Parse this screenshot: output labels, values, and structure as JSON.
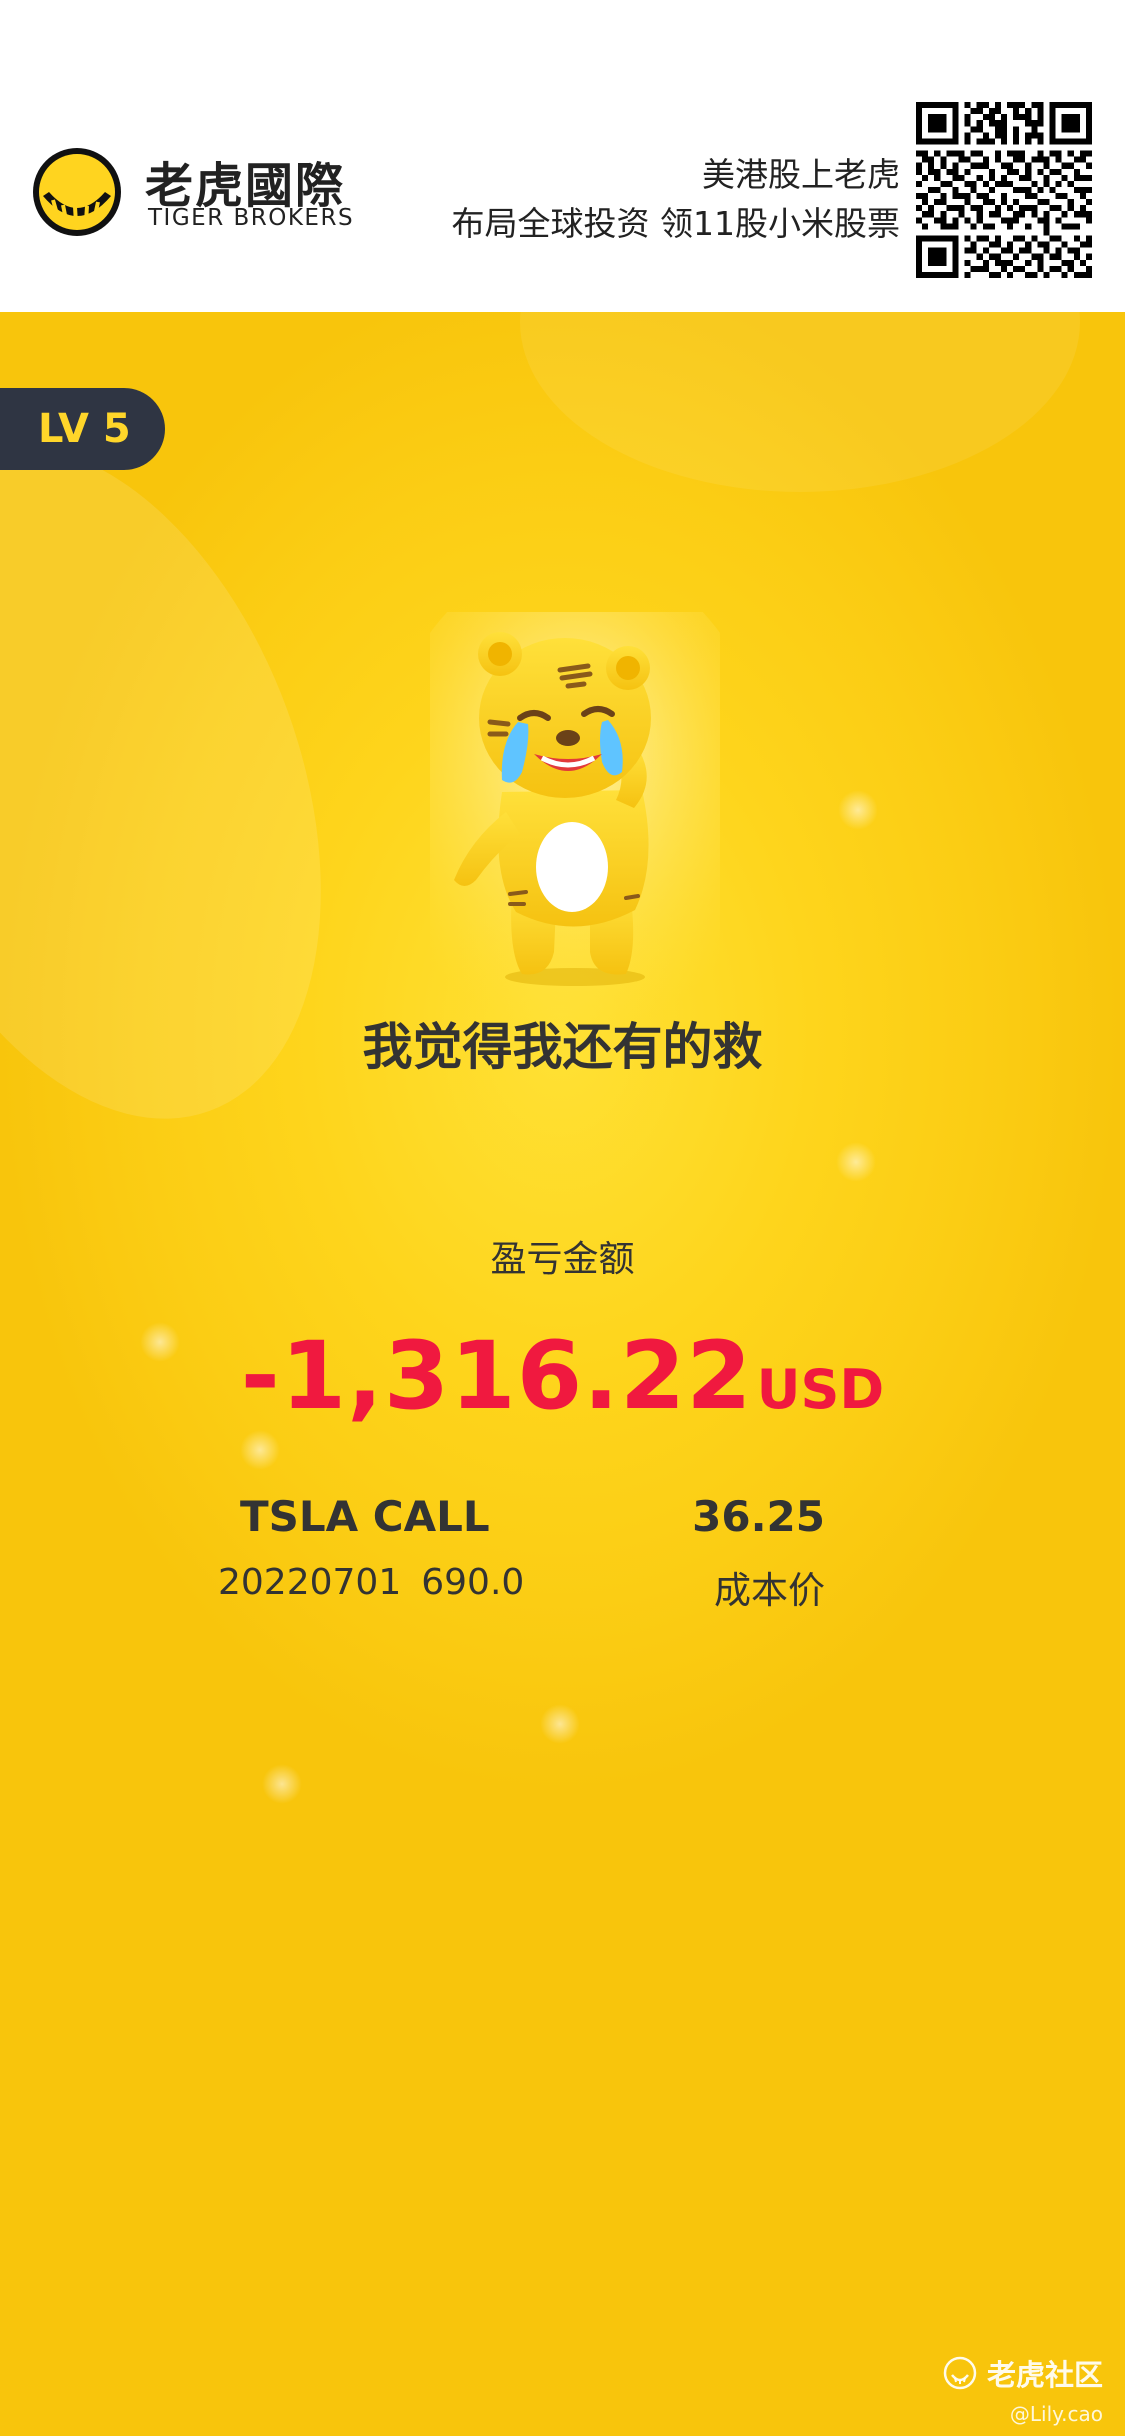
{
  "header": {
    "brand_name_cn": "老虎國際",
    "brand_name_en": "TIGER BROKERS",
    "promo_line_1": "美港股上老虎",
    "promo_line_2": "布局全球投资 领11股小米股票"
  },
  "card": {
    "level_badge": "LV 5",
    "mood_text": "我觉得我还有的救",
    "pnl_label": "盈亏金额",
    "pnl_value": "-1,316.22",
    "pnl_currency": "USD",
    "contract": {
      "name": "TSLA CALL",
      "expiry": "20220701",
      "strike": "690.0"
    },
    "cost": {
      "value": "36.25",
      "label": "成本价"
    },
    "watermark": {
      "brand": "老虎社区",
      "user": "@Lily.cao"
    }
  },
  "colors": {
    "brand_yellow": "#fed51c",
    "badge_bg": "#2f3543",
    "loss_red": "#f0193f",
    "text_dark": "#333333"
  },
  "icons": [
    "tiger-logo-icon",
    "qr-code-icon",
    "tiger-mascot-crying",
    "tiger-community-icon"
  ]
}
